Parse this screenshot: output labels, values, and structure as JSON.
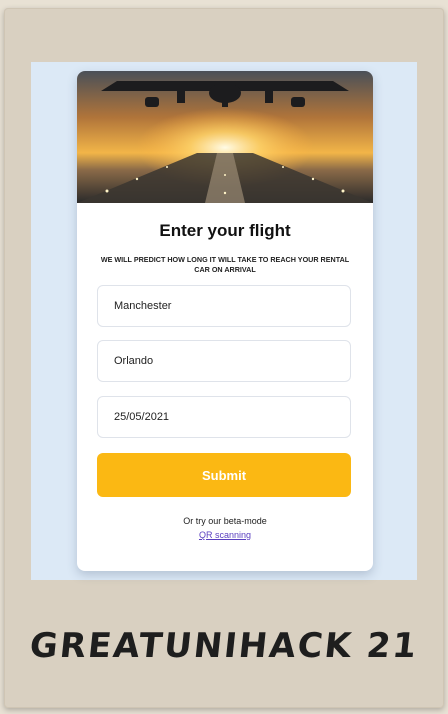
{
  "form": {
    "title": "Enter your flight",
    "subtitle": "WE WILL PREDICT HOW LONG IT WILL TAKE TO REACH YOUR RENTAL CAR ON ARRIVAL",
    "origin_value": "Manchester",
    "destination_value": "Orlando",
    "date_value": "25/05/2021",
    "submit_label": "Submit",
    "beta_text": "Or try our beta-mode",
    "qr_link_label": "QR scanning"
  },
  "caption": "GREATUNIHACK 21",
  "colors": {
    "accent": "#fbb813",
    "link": "#5a3fc0",
    "background": "#dce9f6"
  }
}
